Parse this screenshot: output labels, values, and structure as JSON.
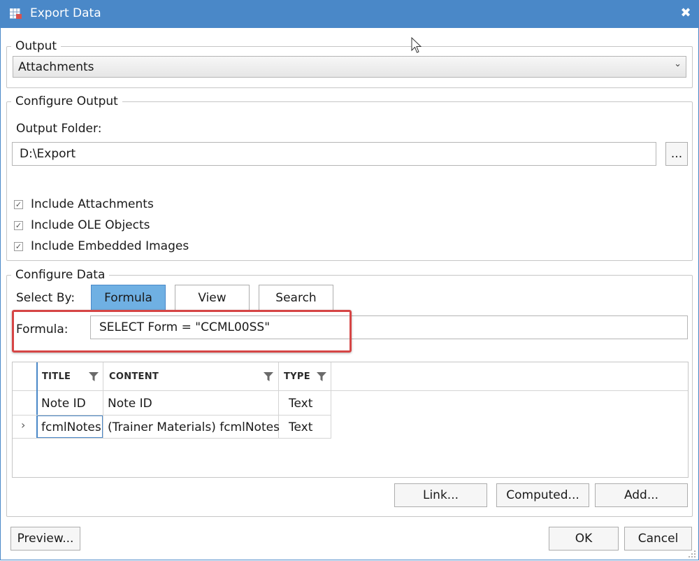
{
  "window": {
    "title": "Export Data",
    "close_glyph": "✖"
  },
  "output": {
    "legend": "Output",
    "selected": "Attachments"
  },
  "configure_output": {
    "legend": "Configure Output",
    "folder_label": "Output Folder:",
    "folder_value": "D:\\Export",
    "browse_label": "...",
    "checkboxes": [
      {
        "label": "Include Attachments",
        "checked": true
      },
      {
        "label": "Include OLE Objects",
        "checked": true
      },
      {
        "label": "Include Embedded Images",
        "checked": true
      }
    ]
  },
  "configure_data": {
    "legend": "Configure Data",
    "select_by_label": "Select By:",
    "tabs": [
      {
        "label": "Formula",
        "active": true
      },
      {
        "label": "View",
        "active": false
      },
      {
        "label": "Search",
        "active": false
      }
    ],
    "formula_label": "Formula:",
    "formula_value": "SELECT Form = \"CCML00SS\"",
    "columns": [
      "TITLE",
      "CONTENT",
      "TYPE"
    ],
    "rows": [
      {
        "title": "Note ID",
        "content": "Note ID",
        "type": "Text",
        "expander": ""
      },
      {
        "title": "fcmlNotes",
        "content": "(Trainer Materials) fcmlNotes",
        "type": "Text",
        "expander": "›"
      }
    ],
    "buttons": {
      "link": "Link...",
      "computed": "Computed...",
      "add": "Add..."
    }
  },
  "footer": {
    "preview": "Preview...",
    "ok": "OK",
    "cancel": "Cancel"
  },
  "colors": {
    "titlebar": "#4a88c8",
    "active_tab": "#6fb0e3",
    "highlight": "#d64545"
  },
  "icons": [
    "table-export-icon",
    "close-icon",
    "chevron-down-icon",
    "checkmark-icon",
    "filter-icon",
    "row-expander-icon",
    "mouse-cursor-icon",
    "resize-grip-icon"
  ]
}
